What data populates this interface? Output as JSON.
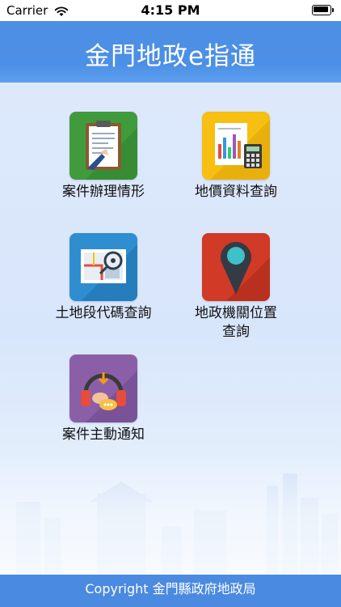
{
  "status_bar": {
    "carrier": "Carrier",
    "time": "4:15 PM",
    "wifi_icon": "wifi-icon",
    "battery_icon": "battery-icon"
  },
  "header": {
    "title": "金門地政e指通"
  },
  "menu": {
    "items": [
      {
        "label": "案件辦理情形",
        "icon": "clipboard-document-icon",
        "color": "#3f9b3c"
      },
      {
        "label": "地價資料查詢",
        "icon": "chart-calculator-icon",
        "color": "#f6bf12"
      },
      {
        "label": "土地段代碼查詢",
        "icon": "map-search-icon",
        "color": "#2f8ed0"
      },
      {
        "label": "地政機關位置查詢",
        "icon": "location-pin-icon",
        "color": "#d13a26"
      },
      {
        "label": "案件主動通知",
        "icon": "headset-chat-icon",
        "color": "#8b5fa8"
      }
    ]
  },
  "footer": {
    "text": "Copyright 金門縣政府地政局"
  }
}
